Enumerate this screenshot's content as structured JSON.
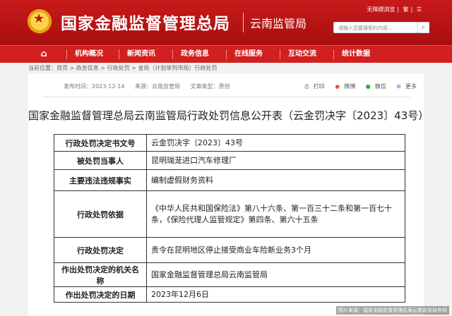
{
  "header": {
    "site_title": "国家金融监督管理总局",
    "branch": "云南监管局",
    "links": [
      "无障碍浏览",
      "繁"
    ],
    "search_placeholder": "请输入您要搜索的内容..."
  },
  "nav": {
    "items": [
      "机构概况",
      "新闻资讯",
      "政务信息",
      "在线服务",
      "互动交流",
      "统计数据"
    ]
  },
  "breadcrumb": {
    "label": "当前位置：",
    "items": [
      "首页",
      "政务信息",
      "行政处罚",
      "省局（计划单列市局）行政处罚"
    ],
    "separator": " > "
  },
  "meta": {
    "date": "发布时间：2023-12-14",
    "source": "来源：云南监管局",
    "type": "文章类型：原创"
  },
  "share": [
    "打印",
    "微博",
    "微信",
    "更多"
  ],
  "doc": {
    "title": "国家金融监督管理总局云南监管局行政处罚信息公开表（云金罚决字〔2023〕43号）"
  },
  "table": {
    "rows": [
      {
        "key": "行政处罚决定书文号",
        "value": "云金罚决字〔2023〕43号"
      },
      {
        "key": "被处罚当事人",
        "value": "昆明瑞茏进口汽车修理厂"
      },
      {
        "key": "主要违法违规事实",
        "value": "编制虚假财务资料"
      },
      {
        "key": "行政处罚依据",
        "value": "《中华人民共和国保险法》第八十六条、第一百三十二条和第一百七十条，《保险代理人监管规定》第四条、第六十五条"
      },
      {
        "key": "行政处罚决定",
        "value": "责令在昆明地区停止接受商业车险新业务3个月"
      },
      {
        "key": "作出处罚决定的机关名称",
        "value": "国家金融监督管理总局云南监管局"
      },
      {
        "key": "作出处罚决定的日期",
        "value": "2023年12月6日"
      }
    ]
  },
  "watermark": "图片来源：国家金融监督管理总局云南监管局官网"
}
